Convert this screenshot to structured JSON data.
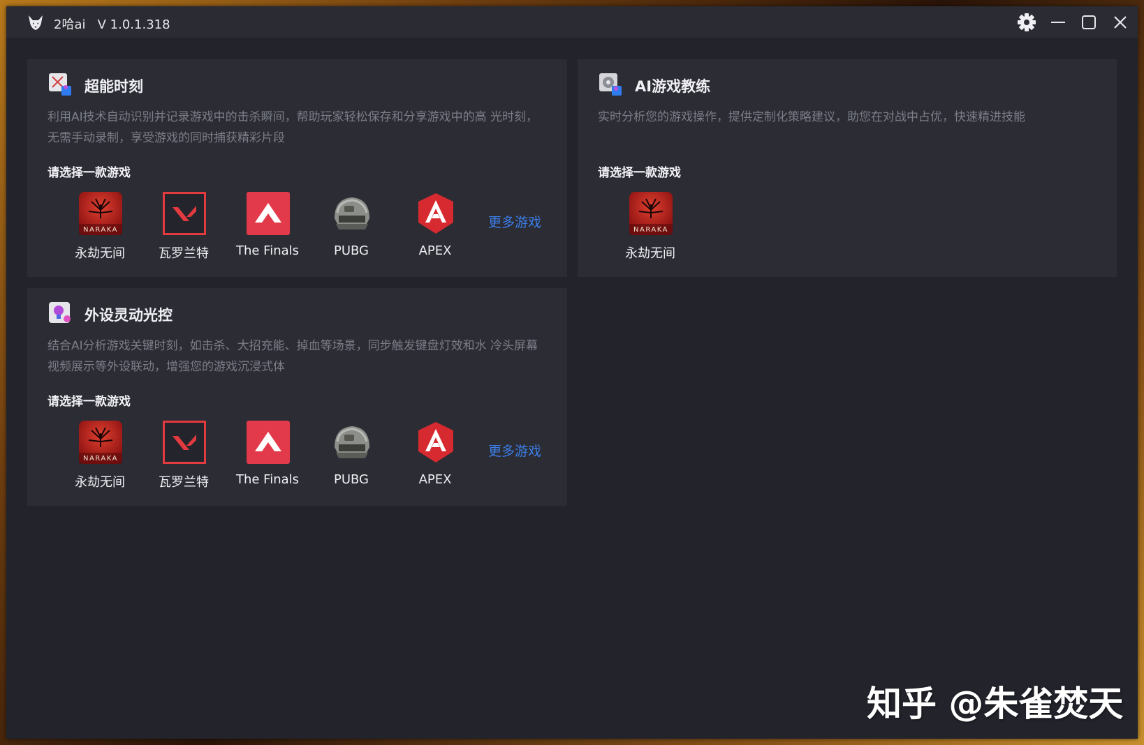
{
  "titlebar": {
    "title": "2哈ai   V 1.0.1.318",
    "icons": [
      "husky-logo-icon",
      "gear-icon",
      "minimize-icon",
      "maximize-icon",
      "close-icon"
    ]
  },
  "cards": {
    "highlights": {
      "title": "超能时刻",
      "description": "利用AI技术自动识别并记录游戏中的击杀瞬间，帮助玩家轻松保存和分享游戏中的高 光时刻，无需手动录制，享受游戏的同时捕获精彩片段",
      "prompt": "请选择一款游戏",
      "games": [
        {
          "label": "永劫无间",
          "icon": "naraka-icon"
        },
        {
          "label": "瓦罗兰特",
          "icon": "valorant-icon"
        },
        {
          "label": "The Finals",
          "icon": "the-finals-icon"
        },
        {
          "label": "PUBG",
          "icon": "pubg-helmet-icon"
        },
        {
          "label": "APEX",
          "icon": "apex-icon"
        }
      ],
      "more_label": "更多游戏"
    },
    "coach": {
      "title": "AI游戏教练",
      "description": "实时分析您的游戏操作，提供定制化策略建议，助您在对战中占优，快速精进技能",
      "prompt": "请选择一款游戏",
      "games": [
        {
          "label": "永劫无间",
          "icon": "naraka-icon"
        }
      ]
    },
    "lighting": {
      "title": "外设灵动光控",
      "description": "结合AI分析游戏关键时刻，如击杀、大招充能、掉血等场景，同步触发键盘灯效和水 冷头屏幕视频展示等外设联动，增强您的游戏沉浸式体",
      "prompt": "请选择一款游戏",
      "games": [
        {
          "label": "永劫无间",
          "icon": "naraka-icon"
        },
        {
          "label": "瓦罗兰特",
          "icon": "valorant-icon"
        },
        {
          "label": "The Finals",
          "icon": "the-finals-icon"
        },
        {
          "label": "PUBG",
          "icon": "pubg-helmet-icon"
        },
        {
          "label": "APEX",
          "icon": "apex-icon"
        }
      ],
      "more_label": "更多游戏"
    }
  },
  "watermark": "知乎 @朱雀焚天",
  "colors": {
    "window_bg": "#22232b",
    "card_bg": "#2b2c34",
    "titlebar_bg": "#2a2b33",
    "link": "#3c7ee8",
    "game_red": "#e23a3f"
  }
}
